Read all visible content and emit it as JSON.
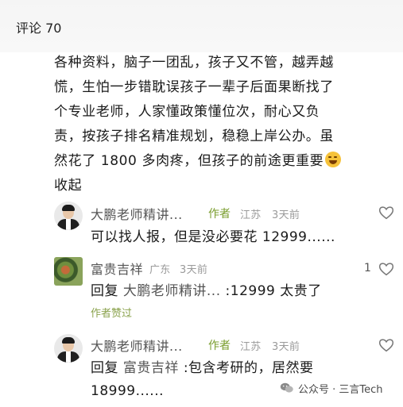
{
  "header": {
    "title": "评论 70"
  },
  "post": {
    "lines": [
      "各种资料，脑子一团乱，孩子又不管，越弄越",
      "慌，生怕一步错耽误孩子一辈子后面果断找了",
      "个专业老师，人家懂政策懂位次，耐心又负",
      "责，按孩子排名精准规划，稳稳上岸公办。虽",
      "然花了 1800 多肉疼，但孩子的前途更重要"
    ],
    "emoji": "laughing-tears-emoji",
    "collapse_label": "收起"
  },
  "comments": [
    {
      "name": "大鹏老师精讲...",
      "author_tag": "作者",
      "region": "江苏",
      "time": "3天前",
      "content": "可以找人报，但是没必要花 12999......",
      "likes": ""
    },
    {
      "name": "富贵吉祥",
      "region": "广东",
      "time": "3天前",
      "reply_prefix": "回复",
      "reply_to": "大鹏老师精讲...",
      "content": ":12999 太贵了",
      "liked_by_author": "作者赞过",
      "likes": "1"
    },
    {
      "name": "大鹏老师精讲...",
      "author_tag": "作者",
      "region": "江苏",
      "time": "3天前",
      "reply_prefix": "回复",
      "reply_to": "富贵吉祥",
      "content": ":包含考研的，居然要",
      "content_line2": "18999......",
      "likes": ""
    }
  ],
  "watermark": {
    "text": "公众号 · 三言Tech",
    "icon": "wechat-icon"
  },
  "colors": {
    "author_tag": "#7a9d2e",
    "meta": "#9a9a9a",
    "liked": "#8aa24c"
  }
}
